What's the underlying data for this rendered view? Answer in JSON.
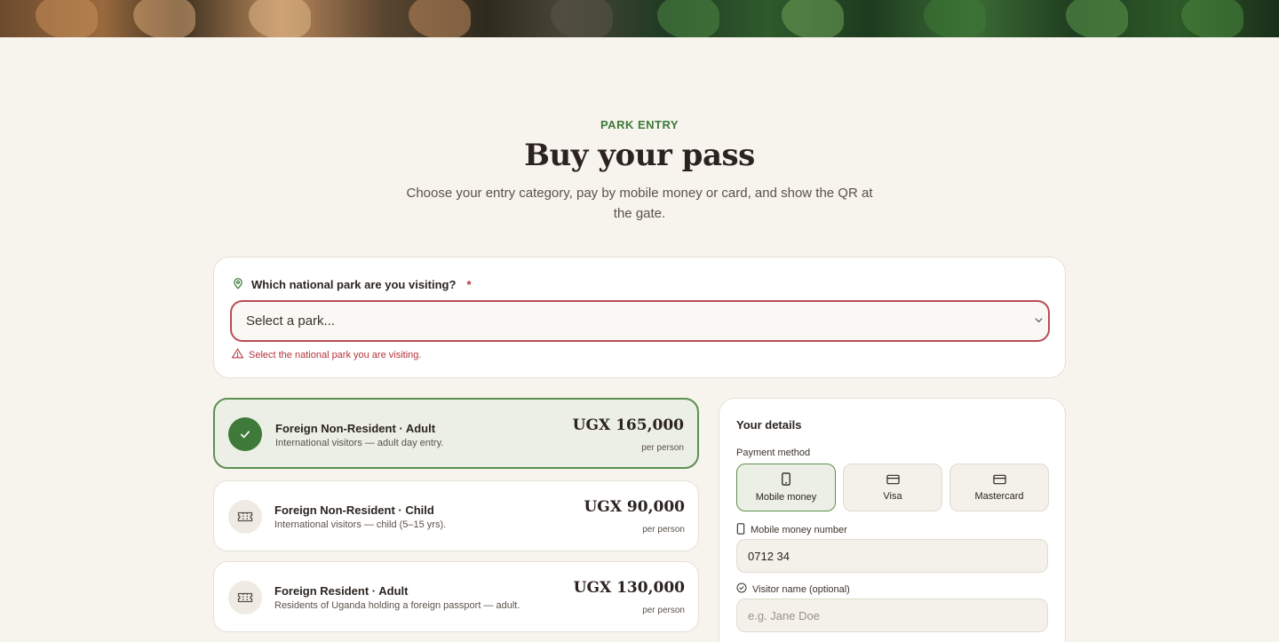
{
  "header": {
    "eyebrow": "PARK ENTRY",
    "title": "Buy your pass",
    "subtitle": "Choose your entry category, pay by mobile money or card, and show the QR at the gate."
  },
  "park": {
    "label": "Which national park are you visiting?",
    "required_mark": "*",
    "placeholder": "Select a park...",
    "error": "Select the national park you are visiting."
  },
  "tickets": [
    {
      "name": "Foreign Non-Resident · Adult",
      "desc": "International visitors — adult day entry.",
      "price": "UGX 165,000",
      "per": "per person",
      "selected": true
    },
    {
      "name": "Foreign Non-Resident · Child",
      "desc": "International visitors — child (5–15 yrs).",
      "price": "UGX 90,000",
      "per": "per person",
      "selected": false
    },
    {
      "name": "Foreign Resident · Adult",
      "desc": "Residents of Uganda holding a foreign passport — adult.",
      "price": "UGX 130,000",
      "per": "per person",
      "selected": false
    }
  ],
  "details": {
    "title": "Your details",
    "payment_label": "Payment method",
    "methods": [
      "Mobile money",
      "Visa",
      "Mastercard"
    ],
    "selected_method": "Mobile money",
    "mobile_label": "Mobile money number",
    "mobile_value": "0712 34",
    "visitor_label": "Visitor name (optional)",
    "visitor_placeholder": "e.g. Jane Doe"
  },
  "colors": {
    "accent": "#3f7a3a",
    "error": "#b5323a",
    "background": "#f7f4ee"
  }
}
